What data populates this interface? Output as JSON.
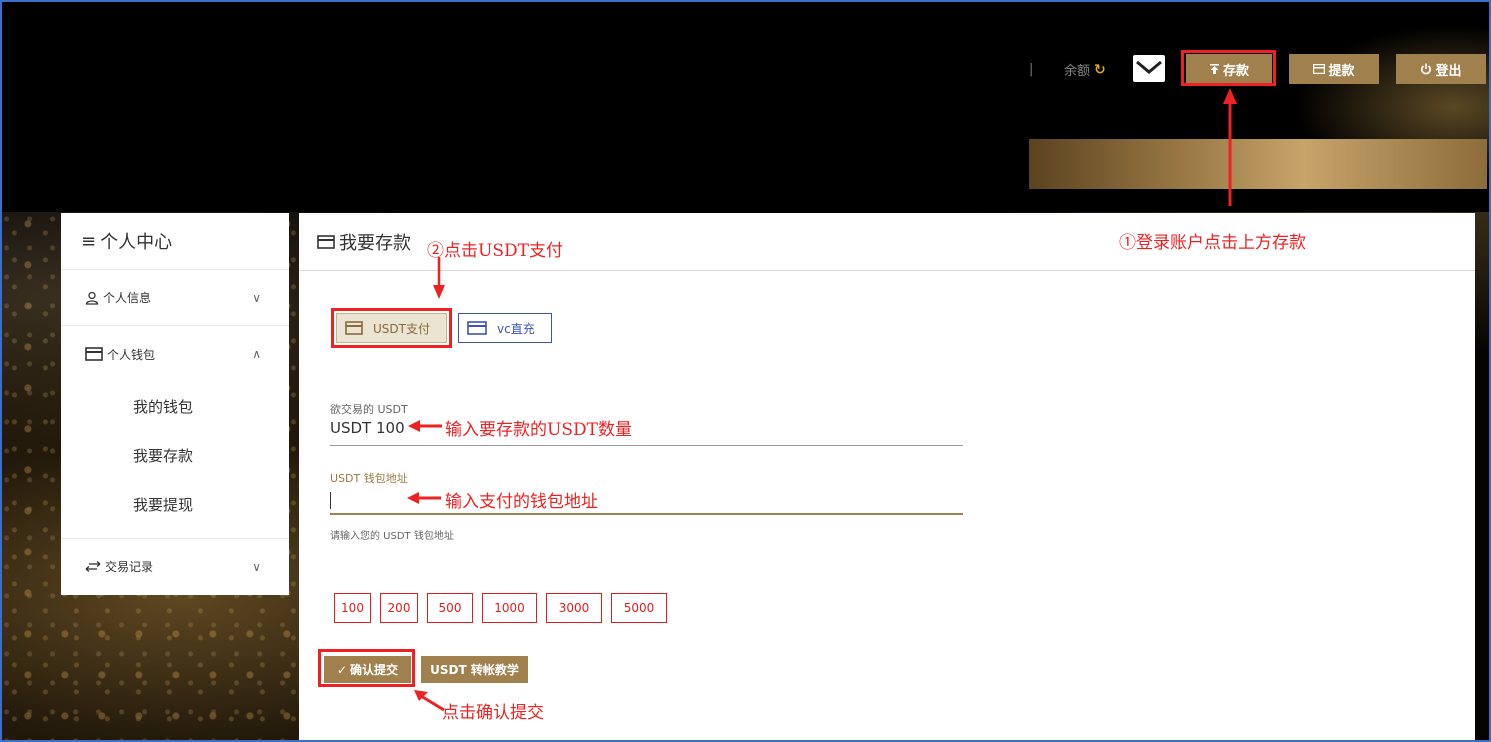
{
  "header": {
    "separator": "|",
    "balance_label": "余额",
    "refresh_icon": "↻",
    "deposit_label": "存款",
    "withdraw_label": "提款",
    "logout_label": "登出"
  },
  "sidebar": {
    "title": "个人中心",
    "items": [
      {
        "label": "个人信息",
        "icon": "user-icon",
        "chevron": "∨"
      },
      {
        "label": "个人钱包",
        "icon": "wallet-icon",
        "chevron": "∧"
      },
      {
        "label": "交易记录",
        "icon": "transfer-icon",
        "chevron": "∨"
      }
    ],
    "wallet_sub": [
      "我的钱包",
      "我要存款",
      "我要提现"
    ]
  },
  "main": {
    "title": "我要存款",
    "tabs": [
      {
        "label": "USDT支付",
        "active": true
      },
      {
        "label": "vc直充",
        "active": false
      }
    ],
    "amount_field": {
      "label": "欲交易的 USDT",
      "value": "USDT 100"
    },
    "address_field": {
      "label": "USDT 钱包地址",
      "value": "",
      "hint": "请输入您的 USDT 钱包地址"
    },
    "quick_amounts": [
      "100",
      "200",
      "500",
      "1000",
      "3000",
      "5000"
    ],
    "confirm_label": "确认提交",
    "tutorial_label": "USDT 转帐教学"
  },
  "annotations": {
    "step1": "①登录账户点击上方存款",
    "step2": "②点击USDT支付",
    "amount_hint": "输入要存款的USDT数量",
    "address_hint": "输入支付的钱包地址",
    "confirm_hint": "点击确认提交"
  },
  "colors": {
    "accent": "#a0804c",
    "annotation": "#e22222",
    "vc_blue": "#3b55b8"
  }
}
